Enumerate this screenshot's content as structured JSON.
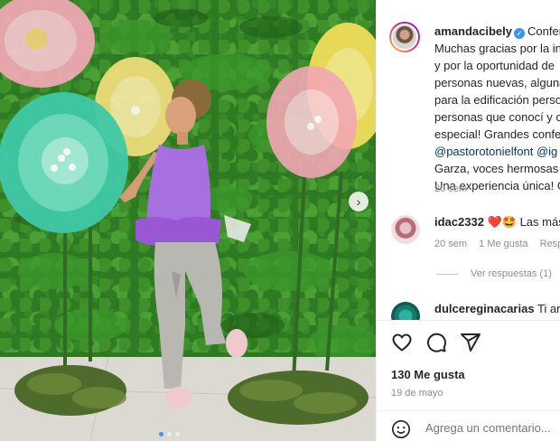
{
  "post": {
    "username": "amandacibely",
    "caption_lines": [
      "Confer",
      "Muchas gracias por la in",
      "y por la oportunidad de",
      "personas nuevas, alguna",
      "para la edificación perso",
      "personas que conocí y c",
      "especial! Grandes confer"
    ],
    "mentions_line": [
      "@pastorotonielfont",
      "@ig"
    ],
    "caption_tail": [
      "Garza, voces hermosas c",
      "Una experiencia única! G"
    ],
    "time": "20 sem"
  },
  "comments": [
    {
      "username": "idac2332",
      "text": "Las más",
      "emojis": [
        "❤️",
        "🤩"
      ],
      "time": "20 sem",
      "likes": "1 Me gusta",
      "reply": "Resp"
    },
    {
      "username": "dulcereginacarias",
      "text": "Ti amo"
    }
  ],
  "view_replies": "Ver respuestas (1)",
  "likes_count": "130 Me gusta",
  "date": "19 de mayo",
  "add_comment_placeholder": "Agrega un comentario...",
  "icons": [
    "heart-icon",
    "comment-icon",
    "share-icon",
    "emoji-icon",
    "verified-icon",
    "next-arrow-icon"
  ],
  "colors": {
    "verified": "#3897f0",
    "link": "#00376b",
    "muted": "#8e8e8e"
  }
}
